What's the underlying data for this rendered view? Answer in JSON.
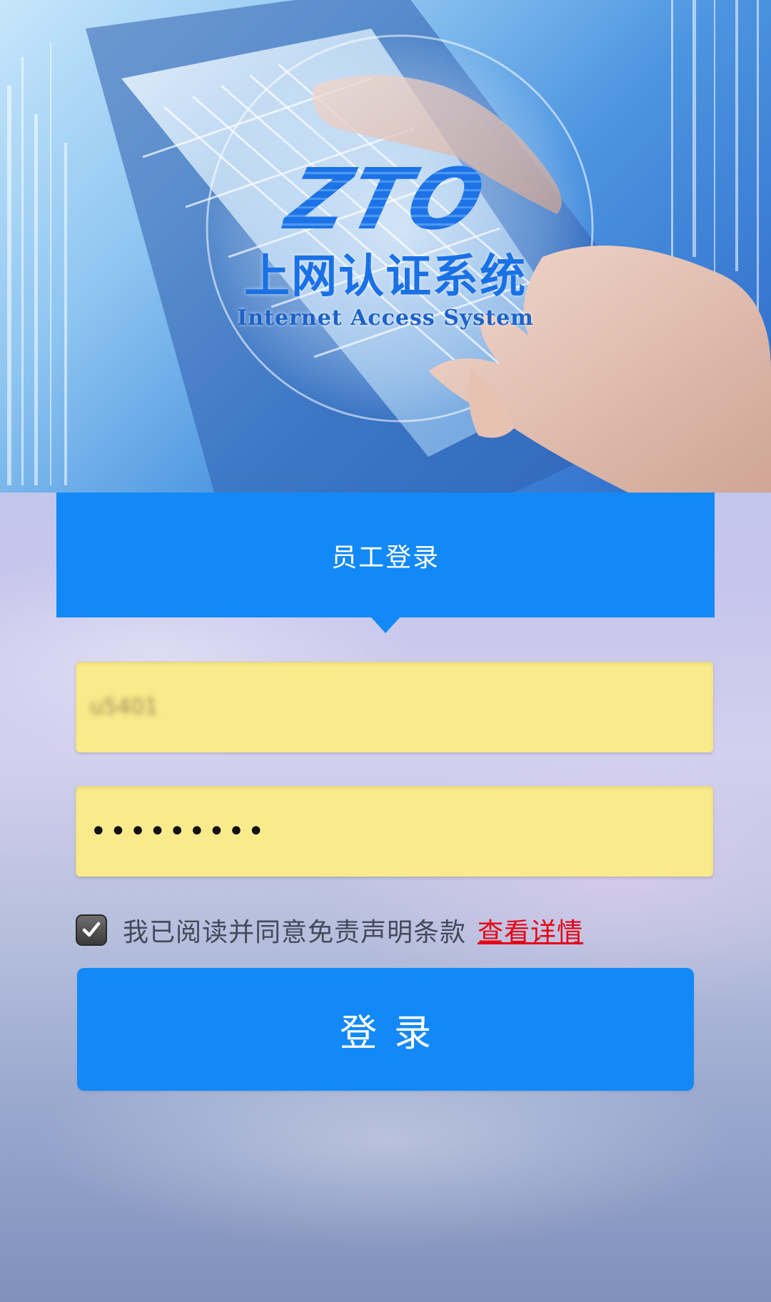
{
  "brand": {
    "logo_text": "ZTO",
    "title_cn": "上网认证系统",
    "title_en": "Internet Access System",
    "primary_color": "#1289F6",
    "field_color": "#F9EA8B",
    "link_color": "#E60012"
  },
  "tab": {
    "label": "员工登录"
  },
  "form": {
    "username_value": "u5401",
    "password_value": "•••••••••"
  },
  "agreement": {
    "checked": true,
    "text": "我已阅读并同意免责声明条款",
    "link_label": "查看详情"
  },
  "login_button": {
    "label": "登录"
  },
  "icons": {
    "checkbox": "check-icon"
  }
}
